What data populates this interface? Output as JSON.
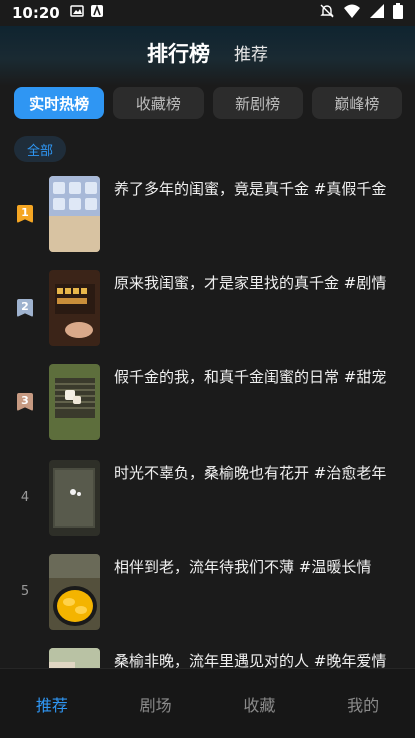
{
  "status": {
    "time": "10:20"
  },
  "header": {
    "title": "排行榜",
    "subtitle": "推荐"
  },
  "tabs": [
    {
      "label": "实时热榜",
      "active": true
    },
    {
      "label": "收藏榜",
      "active": false
    },
    {
      "label": "新剧榜",
      "active": false
    },
    {
      "label": "巅峰榜",
      "active": false
    }
  ],
  "filter": {
    "label": "全部"
  },
  "list": [
    {
      "rank": "1",
      "title": "养了多年的闺蜜，竟是真千金 #真假千金"
    },
    {
      "rank": "2",
      "title": "原来我闺蜜，才是家里找的真千金 #剧情"
    },
    {
      "rank": "3",
      "title": "假千金的我，和真千金闺蜜的日常 #甜宠"
    },
    {
      "rank": "4",
      "title": "时光不辜负，桑榆晚也有花开 #治愈老年"
    },
    {
      "rank": "5",
      "title": "相伴到老，流年待我们不薄 #温暖长情"
    },
    {
      "rank": "",
      "title": "桑榆非晚，流年里遇见对的人 #晚年爱情"
    }
  ],
  "nav": [
    {
      "label": "推荐",
      "active": true
    },
    {
      "label": "剧场",
      "active": false
    },
    {
      "label": "收藏",
      "active": false
    },
    {
      "label": "我的",
      "active": false
    }
  ],
  "colors": {
    "accent": "#2f96f3",
    "gold": "#f5a623",
    "silver": "#9fb3cf",
    "bronze": "#c79a82"
  }
}
